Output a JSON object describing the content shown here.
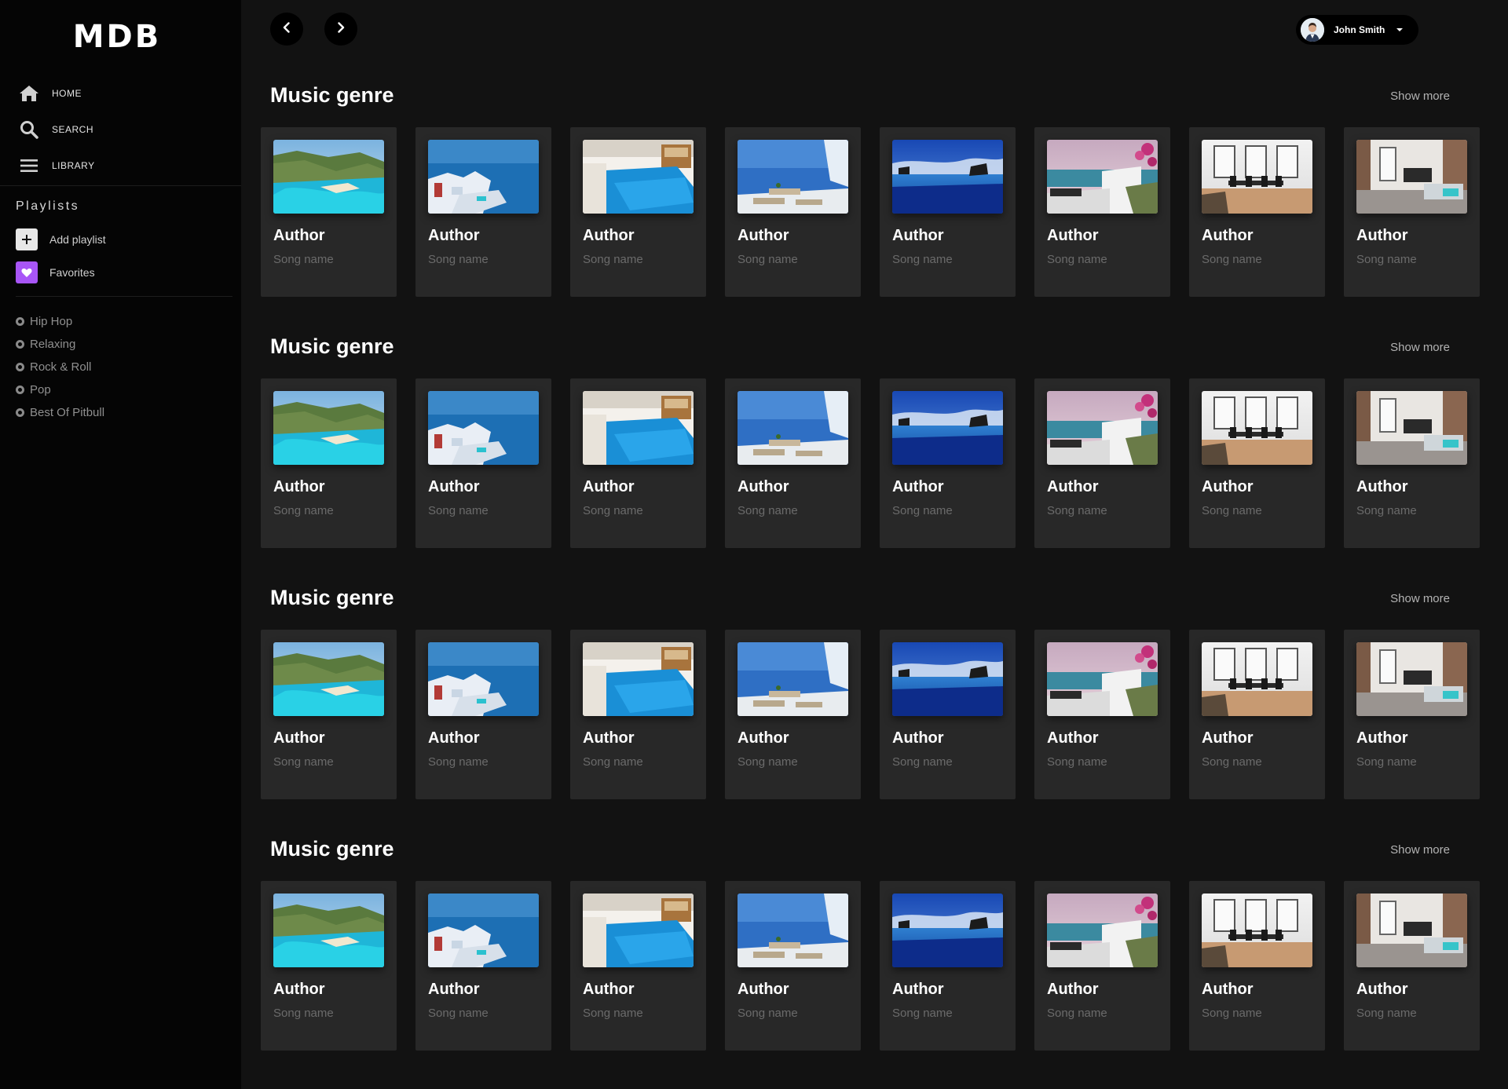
{
  "app": {
    "logo": "MDB"
  },
  "sidebar": {
    "nav": [
      {
        "label": "HOME",
        "icon": "home-icon"
      },
      {
        "label": "SEARCH",
        "icon": "search-icon"
      },
      {
        "label": "LIBRARY",
        "icon": "menu-icon"
      }
    ],
    "playlists_title": "Playlists",
    "add_playlist": "Add playlist",
    "favorites": "Favorites",
    "genres": [
      "Hip Hop",
      "Relaxing",
      "Rock & Roll",
      "Pop",
      "Best Of Pitbull"
    ]
  },
  "topbar": {
    "back_icon": "chevron-left-icon",
    "forward_icon": "chevron-right-icon",
    "user_name": "John Smith"
  },
  "sections": [
    {
      "title": "Music genre",
      "show_more": "Show more",
      "cards": [
        {
          "author": "Author",
          "song": "Song name",
          "image": "bay-cliffs"
        },
        {
          "author": "Author",
          "song": "Song name",
          "image": "santorini-houses"
        },
        {
          "author": "Author",
          "song": "Song name",
          "image": "indoor-pool"
        },
        {
          "author": "Author",
          "song": "Song name",
          "image": "sea-terrace"
        },
        {
          "author": "Author",
          "song": "Song name",
          "image": "infinity-pool"
        },
        {
          "author": "Author",
          "song": "Song name",
          "image": "terrace-flowers"
        },
        {
          "author": "Author",
          "song": "Song name",
          "image": "dining-room"
        },
        {
          "author": "Author",
          "song": "Song name",
          "image": "living-room"
        }
      ]
    },
    {
      "title": "Music genre",
      "show_more": "Show more",
      "cards": [
        {
          "author": "Author",
          "song": "Song name",
          "image": "bay-cliffs"
        },
        {
          "author": "Author",
          "song": "Song name",
          "image": "santorini-houses"
        },
        {
          "author": "Author",
          "song": "Song name",
          "image": "indoor-pool"
        },
        {
          "author": "Author",
          "song": "Song name",
          "image": "sea-terrace"
        },
        {
          "author": "Author",
          "song": "Song name",
          "image": "infinity-pool"
        },
        {
          "author": "Author",
          "song": "Song name",
          "image": "terrace-flowers"
        },
        {
          "author": "Author",
          "song": "Song name",
          "image": "dining-room"
        },
        {
          "author": "Author",
          "song": "Song name",
          "image": "living-room"
        }
      ]
    },
    {
      "title": "Music genre",
      "show_more": "Show more",
      "cards": [
        {
          "author": "Author",
          "song": "Song name",
          "image": "bay-cliffs"
        },
        {
          "author": "Author",
          "song": "Song name",
          "image": "santorini-houses"
        },
        {
          "author": "Author",
          "song": "Song name",
          "image": "indoor-pool"
        },
        {
          "author": "Author",
          "song": "Song name",
          "image": "sea-terrace"
        },
        {
          "author": "Author",
          "song": "Song name",
          "image": "infinity-pool"
        },
        {
          "author": "Author",
          "song": "Song name",
          "image": "terrace-flowers"
        },
        {
          "author": "Author",
          "song": "Song name",
          "image": "dining-room"
        },
        {
          "author": "Author",
          "song": "Song name",
          "image": "living-room"
        }
      ]
    },
    {
      "title": "Music genre",
      "show_more": "Show more",
      "cards": [
        {
          "author": "Author",
          "song": "Song name",
          "image": "bay-cliffs"
        },
        {
          "author": "Author",
          "song": "Song name",
          "image": "santorini-houses"
        },
        {
          "author": "Author",
          "song": "Song name",
          "image": "indoor-pool"
        },
        {
          "author": "Author",
          "song": "Song name",
          "image": "sea-terrace"
        },
        {
          "author": "Author",
          "song": "Song name",
          "image": "infinity-pool"
        },
        {
          "author": "Author",
          "song": "Song name",
          "image": "terrace-flowers"
        },
        {
          "author": "Author",
          "song": "Song name",
          "image": "dining-room"
        },
        {
          "author": "Author",
          "song": "Song name",
          "image": "living-room"
        }
      ]
    }
  ],
  "colors": {
    "background": "#121212",
    "sidebar": "#050505",
    "card": "#282828",
    "favorites_accent": "#a855f7",
    "muted_text": "#6b6b6b"
  }
}
